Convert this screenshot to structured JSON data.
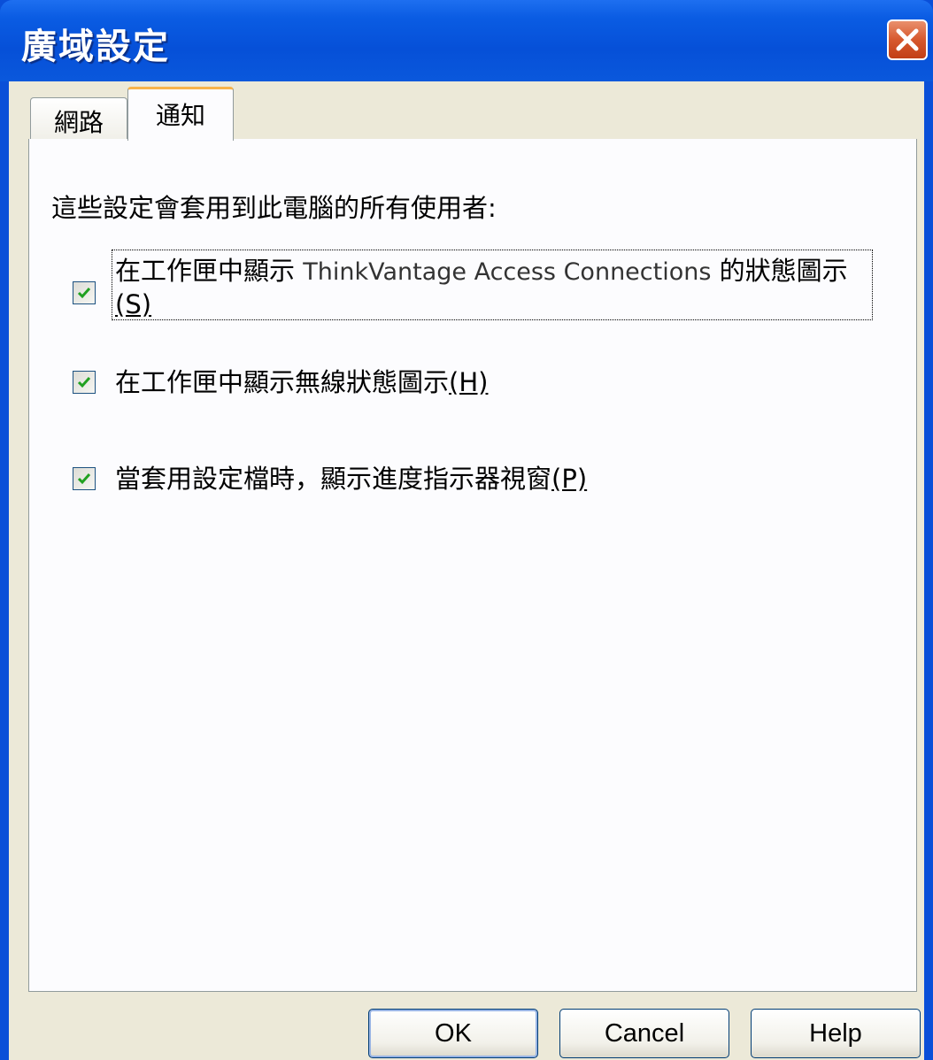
{
  "window": {
    "title": "廣域設定"
  },
  "tabs": [
    {
      "label": "網路"
    },
    {
      "label": "通知"
    }
  ],
  "panel": {
    "description": "這些設定會套用到此電腦的所有使用者:",
    "options": [
      {
        "label_prefix": "在工作匣中顯示 ",
        "label_app": "ThinkVantage Access Connections",
        "label_suffix": " 的狀態圖示",
        "mnemonic": "(S)",
        "checked": true
      },
      {
        "label_prefix": "在工作匣中顯示無線狀態圖示",
        "mnemonic": "(H)",
        "checked": true
      },
      {
        "label_prefix": "當套用設定檔時，顯示進度指示器視窗",
        "mnemonic": "(P)",
        "checked": true
      }
    ]
  },
  "buttons": {
    "ok": "OK",
    "cancel": "Cancel",
    "help": "Help"
  },
  "colors": {
    "titlebar": "#0a58dc",
    "dialog_face": "#ece9d8",
    "check_mark": "#21a121",
    "active_tab_accent": "#f7b34a"
  }
}
